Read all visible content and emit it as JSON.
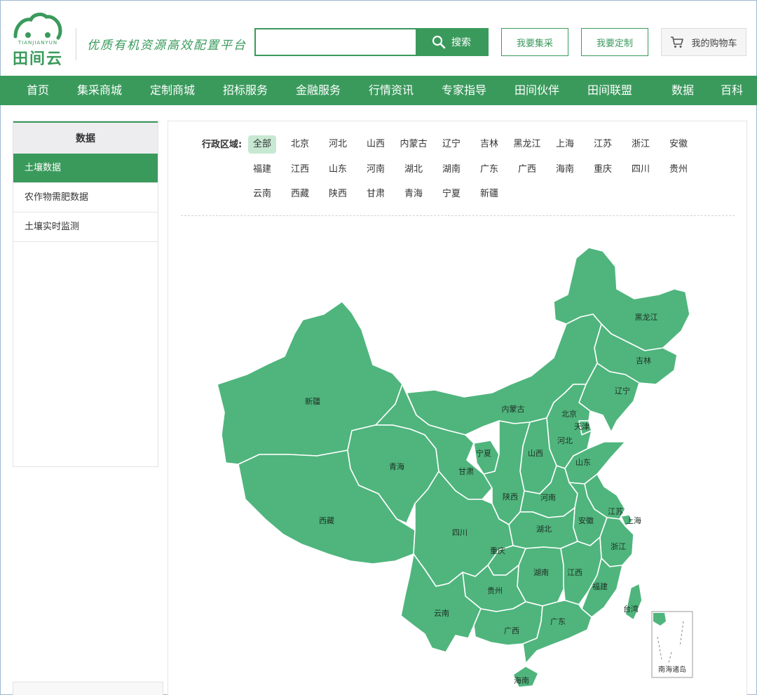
{
  "brand": {
    "sub": "TIANJIANYUN",
    "name": "田间云",
    "slogan": "优质有机资源高效配置平台"
  },
  "header": {
    "search_placeholder": "",
    "search_label": "搜索",
    "buttons": [
      "我要集采",
      "我要定制"
    ],
    "cart_label": "我的购物车"
  },
  "nav": [
    "首页",
    "集采商城",
    "定制商城",
    "招标服务",
    "金融服务",
    "行情资讯",
    "专家指导",
    "田间伙伴",
    "田间联盟",
    "数据",
    "百科"
  ],
  "sidebar": {
    "title": "数据",
    "items": [
      {
        "label": "土壤数据",
        "active": true
      },
      {
        "label": "农作物需肥数据",
        "active": false
      },
      {
        "label": "土壤实时监测",
        "active": false
      }
    ]
  },
  "filter": {
    "label": "行政区域:",
    "rows": [
      [
        "全部",
        "北京",
        "河北",
        "山西",
        "内蒙古",
        "辽宁",
        "吉林",
        "黑龙江",
        "上海",
        "江苏",
        "浙江",
        "安徽"
      ],
      [
        "福建",
        "江西",
        "山东",
        "河南",
        "湖北",
        "湖南",
        "广东",
        "广西",
        "海南",
        "重庆",
        "四川",
        "贵州"
      ],
      [
        "云南",
        "西藏",
        "陕西",
        "甘肃",
        "青海",
        "宁夏",
        "新疆"
      ]
    ],
    "selected": "全部"
  },
  "map": {
    "fill": "#4fb57d",
    "stroke": "#ffffff",
    "provinces": [
      "黑龙江",
      "吉林",
      "辽宁",
      "内蒙古",
      "北京",
      "天津",
      "河北",
      "山西",
      "山东",
      "新疆",
      "青海",
      "甘肃",
      "宁夏",
      "陕西",
      "河南",
      "江苏",
      "上海",
      "安徽",
      "湖北",
      "西藏",
      "四川",
      "重庆",
      "浙江",
      "湖南",
      "江西",
      "贵州",
      "福建",
      "台湾",
      "云南",
      "广西",
      "广东",
      "海南"
    ],
    "inset_label": "南海诸岛"
  },
  "colors": {
    "accent": "#3a9a5c",
    "map_fill": "#4fb57d",
    "active_chip": "#c7e8d2"
  }
}
